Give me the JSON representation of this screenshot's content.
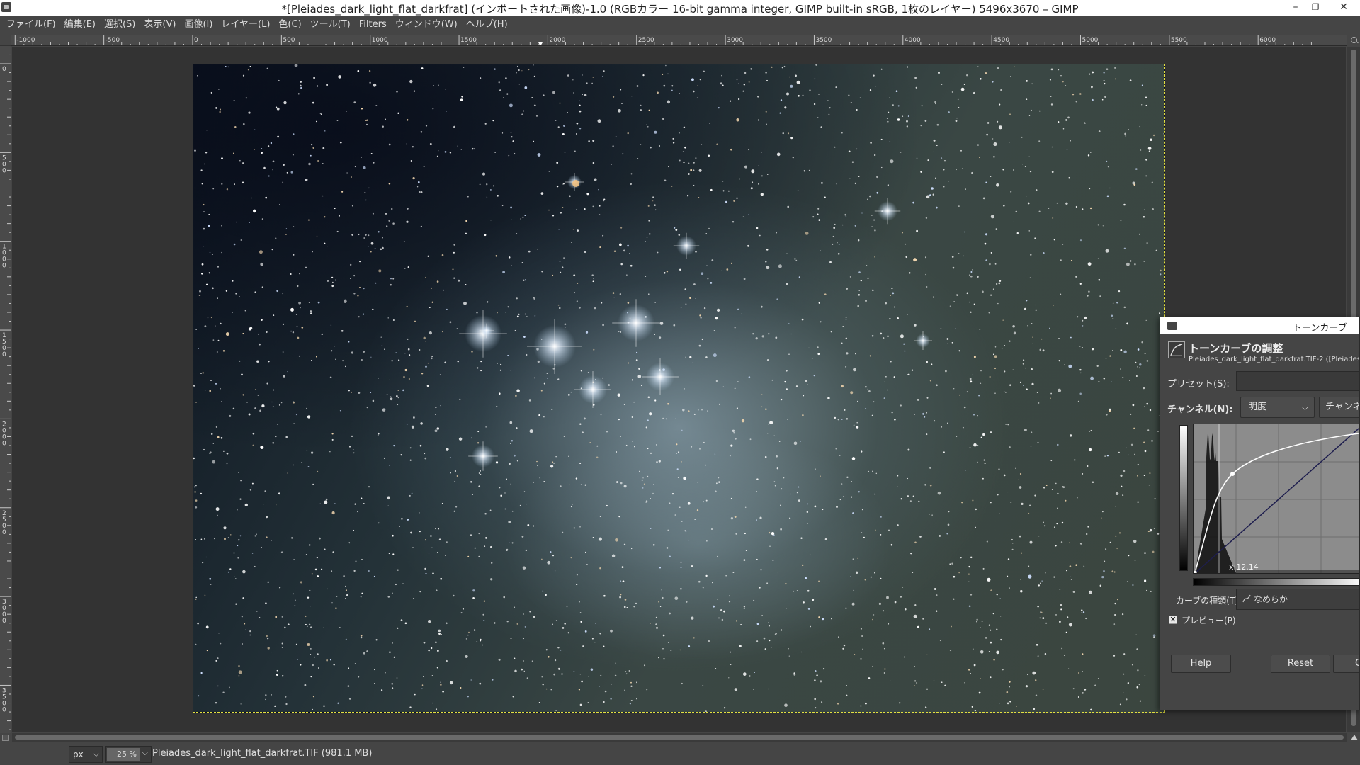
{
  "window": {
    "title": "*[Pleiades_dark_light_flat_darkfrat] (インポートされた画像)-1.0 (RGBカラー 16-bit gamma integer, GIMP built-in sRGB, 1枚のレイヤー) 5496x3670 – GIMP",
    "minimize": "–",
    "restore": "❐",
    "close": "✕"
  },
  "menu": [
    "ファイル(F)",
    "編集(E)",
    "選択(S)",
    "表示(V)",
    "画像(I)",
    "レイヤー(L)",
    "色(C)",
    "ツール(T)",
    "Filters",
    "ウィンドウ(W)",
    "ヘルプ(H)"
  ],
  "ruler": {
    "h_labels": [
      "-1000",
      "-500",
      "0",
      "500",
      "1000",
      "1500",
      "2000",
      "2500",
      "3000",
      "3500",
      "4000",
      "4500",
      "5000",
      "5500",
      "6000"
    ],
    "v_labels": [
      "0",
      "500",
      "1000",
      "1500",
      "2000",
      "2500",
      "3000",
      "3500"
    ]
  },
  "status": {
    "unit": "px",
    "zoom": "25 %",
    "file_info": "Pleiades_dark_light_flat_darkfrat.TIF (981.1 MB)"
  },
  "curves_dialog": {
    "window_title": "トーンカーブ",
    "heading": "トーンカーブの調整",
    "subtitle": "Pleiades_dark_light_flat_darkfrat.TIF-2 ([Pleiades_",
    "preset_label": "プリセット(S):",
    "channel_label": "チャンネル(N):",
    "channel_value": "明度",
    "channel_reset_label": "チャンネ",
    "cursor_readout": "x:12.14",
    "curve_type_label": "カーブの種類(T)",
    "curve_type_value": "なめらか",
    "preview_label": "プレビュー(P)",
    "preview_checked": true,
    "help_button": "Help",
    "reset_button": "Reset",
    "ok_button": "O"
  },
  "colors": {
    "selection_outline": "#e4e040",
    "canvas_background": "#333333",
    "ui_background": "#454545"
  }
}
